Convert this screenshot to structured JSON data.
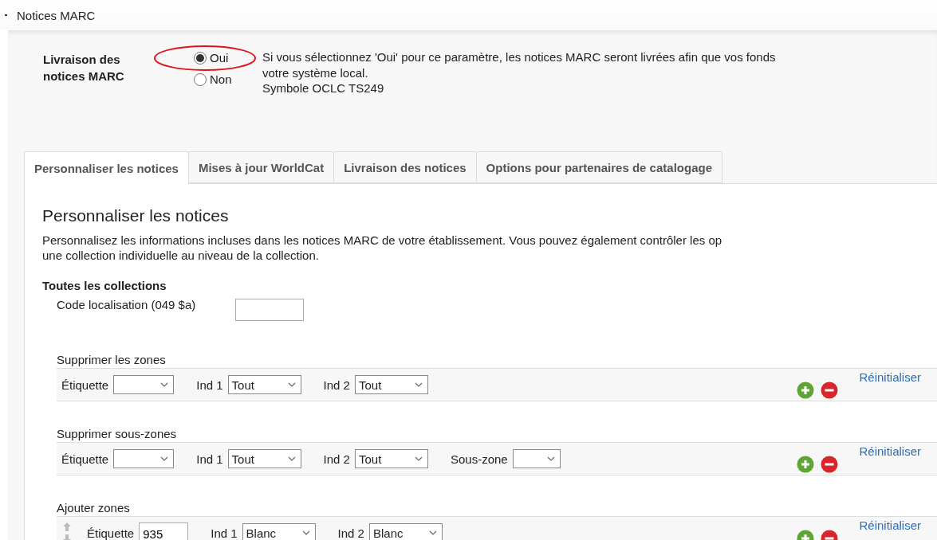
{
  "header": {
    "title": "Notices MARC"
  },
  "delivery": {
    "label": "Livraison des notices MARC",
    "options": [
      {
        "label": "Oui",
        "selected": true
      },
      {
        "label": "Non",
        "selected": false
      }
    ],
    "description": [
      "Si vous sélectionnez 'Oui' pour ce paramètre, les notices MARC seront livrées afin que vos fonds",
      "votre système local.",
      "Symbole OCLC TS249"
    ],
    "annotation": {
      "kind": "ellipse"
    }
  },
  "tabs": [
    {
      "label": "Personnaliser les notices",
      "selected": true
    },
    {
      "label": "Mises à jour WorldCat",
      "selected": false
    },
    {
      "label": "Livraison des notices",
      "selected": false
    },
    {
      "label": "Options pour partenaires de catalogage",
      "selected": false
    }
  ],
  "panel": {
    "title": "Personnaliser les notices",
    "intro": [
      "Personnalisez les informations incluses dans les notices MARC de votre établissement. Vous pouvez également contrôler les op",
      "une collection individuelle au niveau de la collection."
    ],
    "section": "Toutes les collections",
    "location": {
      "label": "Code localisation (049 $a)"
    },
    "groups": [
      {
        "title": "Supprimer les zones",
        "reset": "Réinitialiser",
        "fields": [
          {
            "kind": "select",
            "label": "Étiquette"
          },
          {
            "kind": "select",
            "label": "Ind 1",
            "value": "Tout"
          },
          {
            "kind": "select",
            "label": "Ind 2",
            "value": "Tout"
          }
        ]
      },
      {
        "title": "Supprimer sous-zones",
        "reset": "Réinitialiser",
        "fields": [
          {
            "kind": "select",
            "label": "Étiquette"
          },
          {
            "kind": "select",
            "label": "Ind 1",
            "value": "Tout"
          },
          {
            "kind": "select",
            "label": "Ind 2",
            "value": "Tout"
          },
          {
            "kind": "select",
            "label": "Sous-zone",
            "narrow": true
          }
        ]
      },
      {
        "title": "Ajouter zones",
        "reset": "Réinitialiser",
        "fields": [
          {
            "kind": "handle"
          },
          {
            "kind": "input",
            "label": "Étiquette",
            "value": "935"
          },
          {
            "kind": "select",
            "label": "Ind 1",
            "value": "Blanc"
          },
          {
            "kind": "select",
            "label": "Ind 2",
            "value": "Blanc"
          }
        ]
      }
    ]
  }
}
